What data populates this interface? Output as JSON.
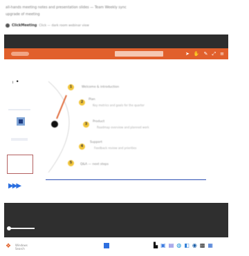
{
  "email": {
    "line1": "all-hands meeting notes and presentation slides — Team Weekly sync",
    "line2": "upgrade of meeting"
  },
  "meeting": {
    "name": "ClickMeeting",
    "subtitle": "Click — dark room webinar view"
  },
  "toolbar": {
    "toggle_label": "",
    "text": "",
    "icons": [
      "cursor-icon",
      "hand-icon",
      "pencil-icon",
      "expand-icon",
      "menu-icon"
    ]
  },
  "steps": [
    {
      "number": "1",
      "label": "Welcome & introduction",
      "sub": ""
    },
    {
      "number": "2",
      "label": "Plan",
      "sub": "Key metrics and goals for the quarter"
    },
    {
      "number": "3",
      "label": "Product",
      "sub": "Roadmap overview and planned work"
    },
    {
      "number": "4",
      "label": "Support",
      "sub": "Feedback review and priorities"
    },
    {
      "number": "5",
      "label": "Q&A — next steps",
      "sub": ""
    }
  ],
  "taskbar": {
    "start_label": "Windows",
    "start_sub": "Search",
    "tray_icons": [
      "widgets",
      "files",
      "chat",
      "browser",
      "mail",
      "store",
      "security",
      "terminal",
      "app"
    ]
  },
  "colors": {
    "accent": "#e1602c",
    "dark": "#2d2d2d",
    "step": "#f2c53a",
    "line": "#2b4fb3"
  }
}
